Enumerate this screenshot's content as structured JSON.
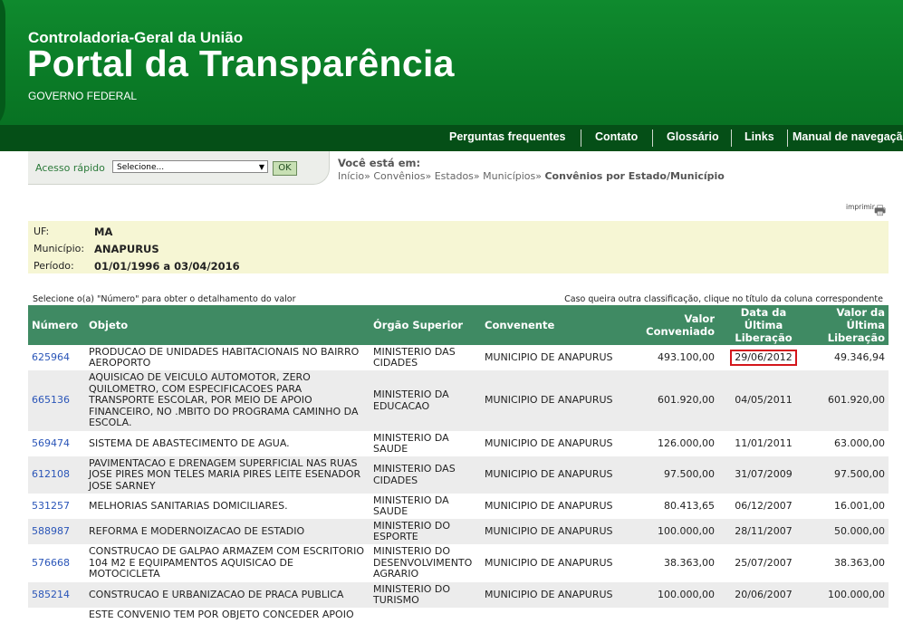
{
  "header": {
    "org": "Controladoria-Geral da União",
    "title": "Portal da Transparência",
    "subtitle": "GOVERNO FEDERAL"
  },
  "nav": {
    "items": [
      "Perguntas frequentes",
      "Contato",
      "Glossário",
      "Links",
      "Manual de navegação"
    ]
  },
  "quick_access": {
    "label": "Acesso rápido",
    "select_value": "Selecione...",
    "ok_label": "OK"
  },
  "breadcrumb": {
    "title": "Você está em:",
    "items": [
      "Início",
      "Convênios",
      "Estados",
      "Municípios"
    ],
    "current": "Convênios por Estado/Município"
  },
  "print_label": "imprimir",
  "info": {
    "uf_label": "UF:",
    "uf_value": "MA",
    "municipio_label": "Município:",
    "municipio_value": "ANAPURUS",
    "periodo_label": "Período:",
    "periodo_value": "01/01/1996 a 03/04/2016"
  },
  "notes": {
    "left": "Selecione o(a) \"Número\" para obter o detalhamento do valor",
    "right": "Caso queira outra classificação, clique no título da coluna correspondente"
  },
  "table": {
    "headers": [
      "Número",
      "Objeto",
      "Órgão Superior",
      "Convenente",
      "Valor Conveniado",
      "Data da Última Liberação",
      "Valor da Última Liberação"
    ],
    "rows": [
      {
        "numero": "625964",
        "objeto": "PRODUCAO DE UNIDADES HABITACIONAIS NO BAIRRO AEROPORTO",
        "orgao": "MINISTERIO DAS CIDADES",
        "convenente": "MUNICIPIO DE ANAPURUS",
        "valor": "493.100,00",
        "data": "29/06/2012",
        "ultima": "49.346,94"
      },
      {
        "numero": "665136",
        "objeto": "AQUISICAO DE VEICULO AUTOMOTOR, ZERO QUILOMETRO, COM ESPECIFICACOES PARA TRANSPORTE ESCOLAR, POR MEIO DE APOIO FINANCEIRO, NO .MBITO DO PROGRAMA CAMINHO DA ESCOLA.",
        "orgao": "MINISTERIO DA EDUCACAO",
        "convenente": "MUNICIPIO DE ANAPURUS",
        "valor": "601.920,00",
        "data": "04/05/2011",
        "ultima": "601.920,00"
      },
      {
        "numero": "569474",
        "objeto": "SISTEMA DE ABASTECIMENTO DE AGUA.",
        "orgao": "MINISTERIO DA SAUDE",
        "convenente": "MUNICIPIO DE ANAPURUS",
        "valor": "126.000,00",
        "data": "11/01/2011",
        "ultima": "63.000,00"
      },
      {
        "numero": "612108",
        "objeto": "PAVIMENTACAO E DRENAGEM SUPERFICIAL NAS RUAS JOSE PIRES MON TELES MARIA PIRES LEITE ESENADOR JOSE SARNEY",
        "orgao": "MINISTERIO DAS CIDADES",
        "convenente": "MUNICIPIO DE ANAPURUS",
        "valor": "97.500,00",
        "data": "31/07/2009",
        "ultima": "97.500,00"
      },
      {
        "numero": "531257",
        "objeto": "MELHORIAS SANITARIAS DOMICILIARES.",
        "orgao": "MINISTERIO DA SAUDE",
        "convenente": "MUNICIPIO DE ANAPURUS",
        "valor": "80.413,65",
        "data": "06/12/2007",
        "ultima": "16.001,00"
      },
      {
        "numero": "588987",
        "objeto": "REFORMA E MODERNOIZACAO DE ESTADIO",
        "orgao": "MINISTERIO DO ESPORTE",
        "convenente": "MUNICIPIO DE ANAPURUS",
        "valor": "100.000,00",
        "data": "28/11/2007",
        "ultima": "50.000,00"
      },
      {
        "numero": "576668",
        "objeto": "CONSTRUCAO DE GALPAO ARMAZEM COM ESCRITORIO 104 M2 E EQUIPAMENTOS AQUISICAO DE MOTOCICLETA",
        "orgao": "MINISTERIO DO DESENVOLVIMENTO AGRARIO",
        "convenente": "MUNICIPIO DE ANAPURUS",
        "valor": "38.363,00",
        "data": "25/07/2007",
        "ultima": "38.363,00"
      },
      {
        "numero": "585214",
        "objeto": "CONSTRUCAO E URBANIZACAO DE PRACA PUBLICA",
        "orgao": "MINISTERIO DO TURISMO",
        "convenente": "MUNICIPIO DE ANAPURUS",
        "valor": "100.000,00",
        "data": "20/06/2007",
        "ultima": "100.000,00"
      },
      {
        "numero": "",
        "objeto": "ESTE CONVENIO TEM POR OBJETO CONCEDER APOIO",
        "orgao": "",
        "convenente": "",
        "valor": "",
        "data": "",
        "ultima": ""
      }
    ]
  },
  "colors": {
    "header_green": "#0a7a26",
    "nav_green": "#054f17",
    "table_header": "#3f8a63",
    "highlight": "#d4161c"
  }
}
